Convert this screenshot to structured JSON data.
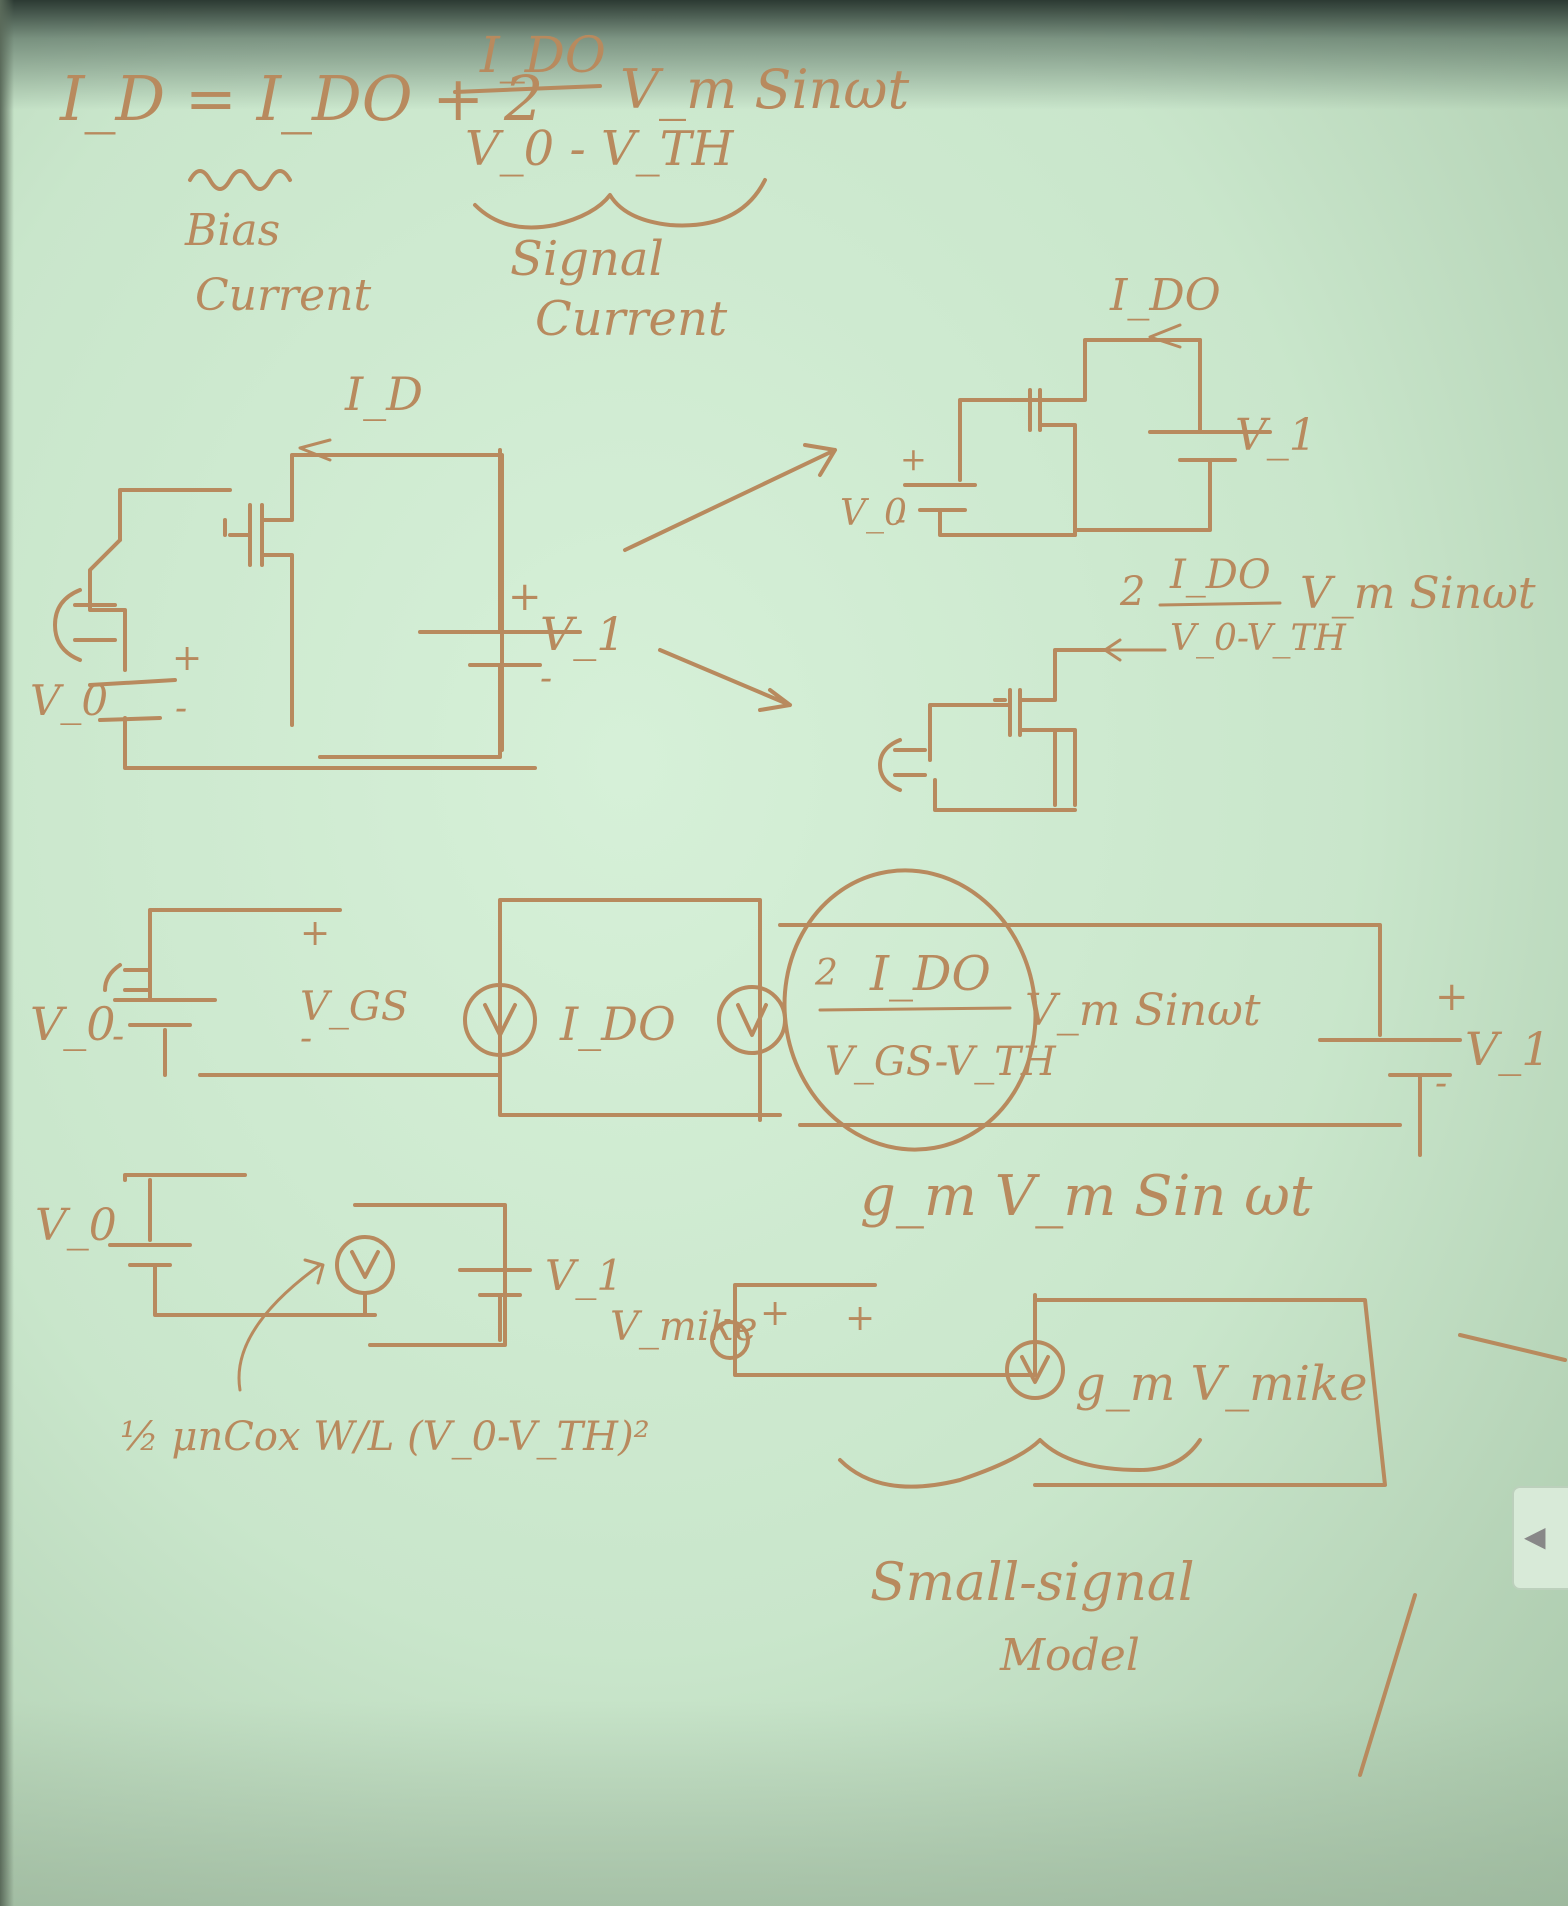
{
  "equation": {
    "lhs": "I_D = I_DO + 2",
    "frac_num": "I_DO",
    "frac_den": "V_0 - V_TH",
    "tail": "V_m Sinωt"
  },
  "labels": {
    "bias_current_1": "Bias",
    "bias_current_2": "Current",
    "signal_current_1": "Signal",
    "signal_current_2": "Current"
  },
  "circuit_main": {
    "id_label": "I_D",
    "v0": "V_0",
    "v1": "V_1",
    "plus": "+",
    "minus": "-"
  },
  "circuit_top_right": {
    "ido_label": "I_DO",
    "v0": "V_0",
    "v1": "V_1",
    "plus": "+",
    "minus": "-"
  },
  "circuit_mid_right": {
    "coef": "2",
    "num": "I_DO",
    "den": "V_0-V_TH",
    "tail": "V_m Sinωt"
  },
  "row3": {
    "v0": "V_0",
    "vgs": "V_GS",
    "plus": "+",
    "minus": "-",
    "ido": "I_DO",
    "coef": "2",
    "num": "I_DO",
    "den": "V_GS-V_TH",
    "tail": "V_m Sinωt",
    "v1": "V_1",
    "gm_expr": "g_m V_m Sin ωt"
  },
  "row4": {
    "v0": "V_0",
    "v1": "V_1",
    "bias_formula": "½ μnCox W/L (V_0-V_TH)²",
    "vmike": "V_mike",
    "gm_vmike": "g_m V_mike"
  },
  "caption": {
    "line1": "Small-signal",
    "line2": "Model"
  },
  "side_tab_glyph": "◀"
}
